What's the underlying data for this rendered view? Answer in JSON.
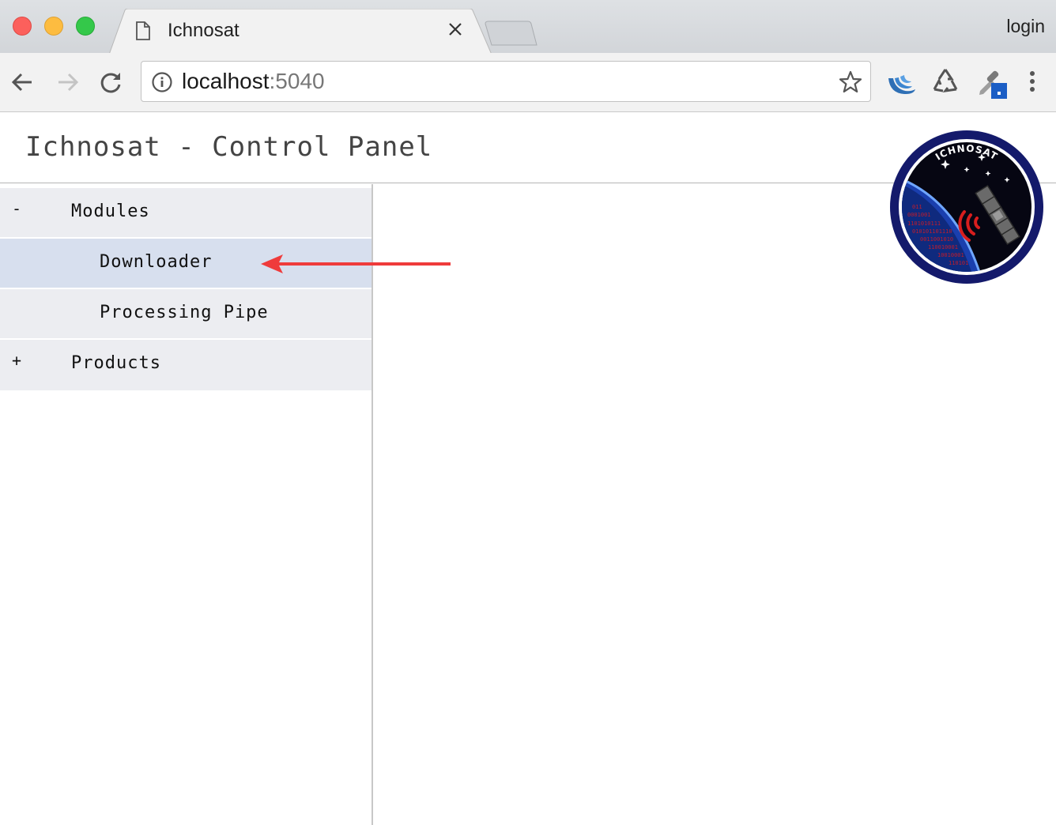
{
  "browser": {
    "tab_title": "Ichnosat",
    "url_host": "localhost",
    "url_port": ":5040",
    "login_label": "login"
  },
  "page": {
    "title": "Ichnosat - Control Panel",
    "logo_text": "ICHNOSAT"
  },
  "sidebar": {
    "modules": {
      "toggle": "-",
      "label": "Modules"
    },
    "downloader": {
      "label": "Downloader"
    },
    "processing_pipe": {
      "label": "Processing Pipe"
    },
    "products": {
      "toggle": "+",
      "label": "Products"
    }
  },
  "colors": {
    "nav_bg": "#ecedf1",
    "nav_active_bg": "#d7dfee",
    "annotation_arrow": "#ef3b3b",
    "logo_ring": "#141a6b"
  }
}
